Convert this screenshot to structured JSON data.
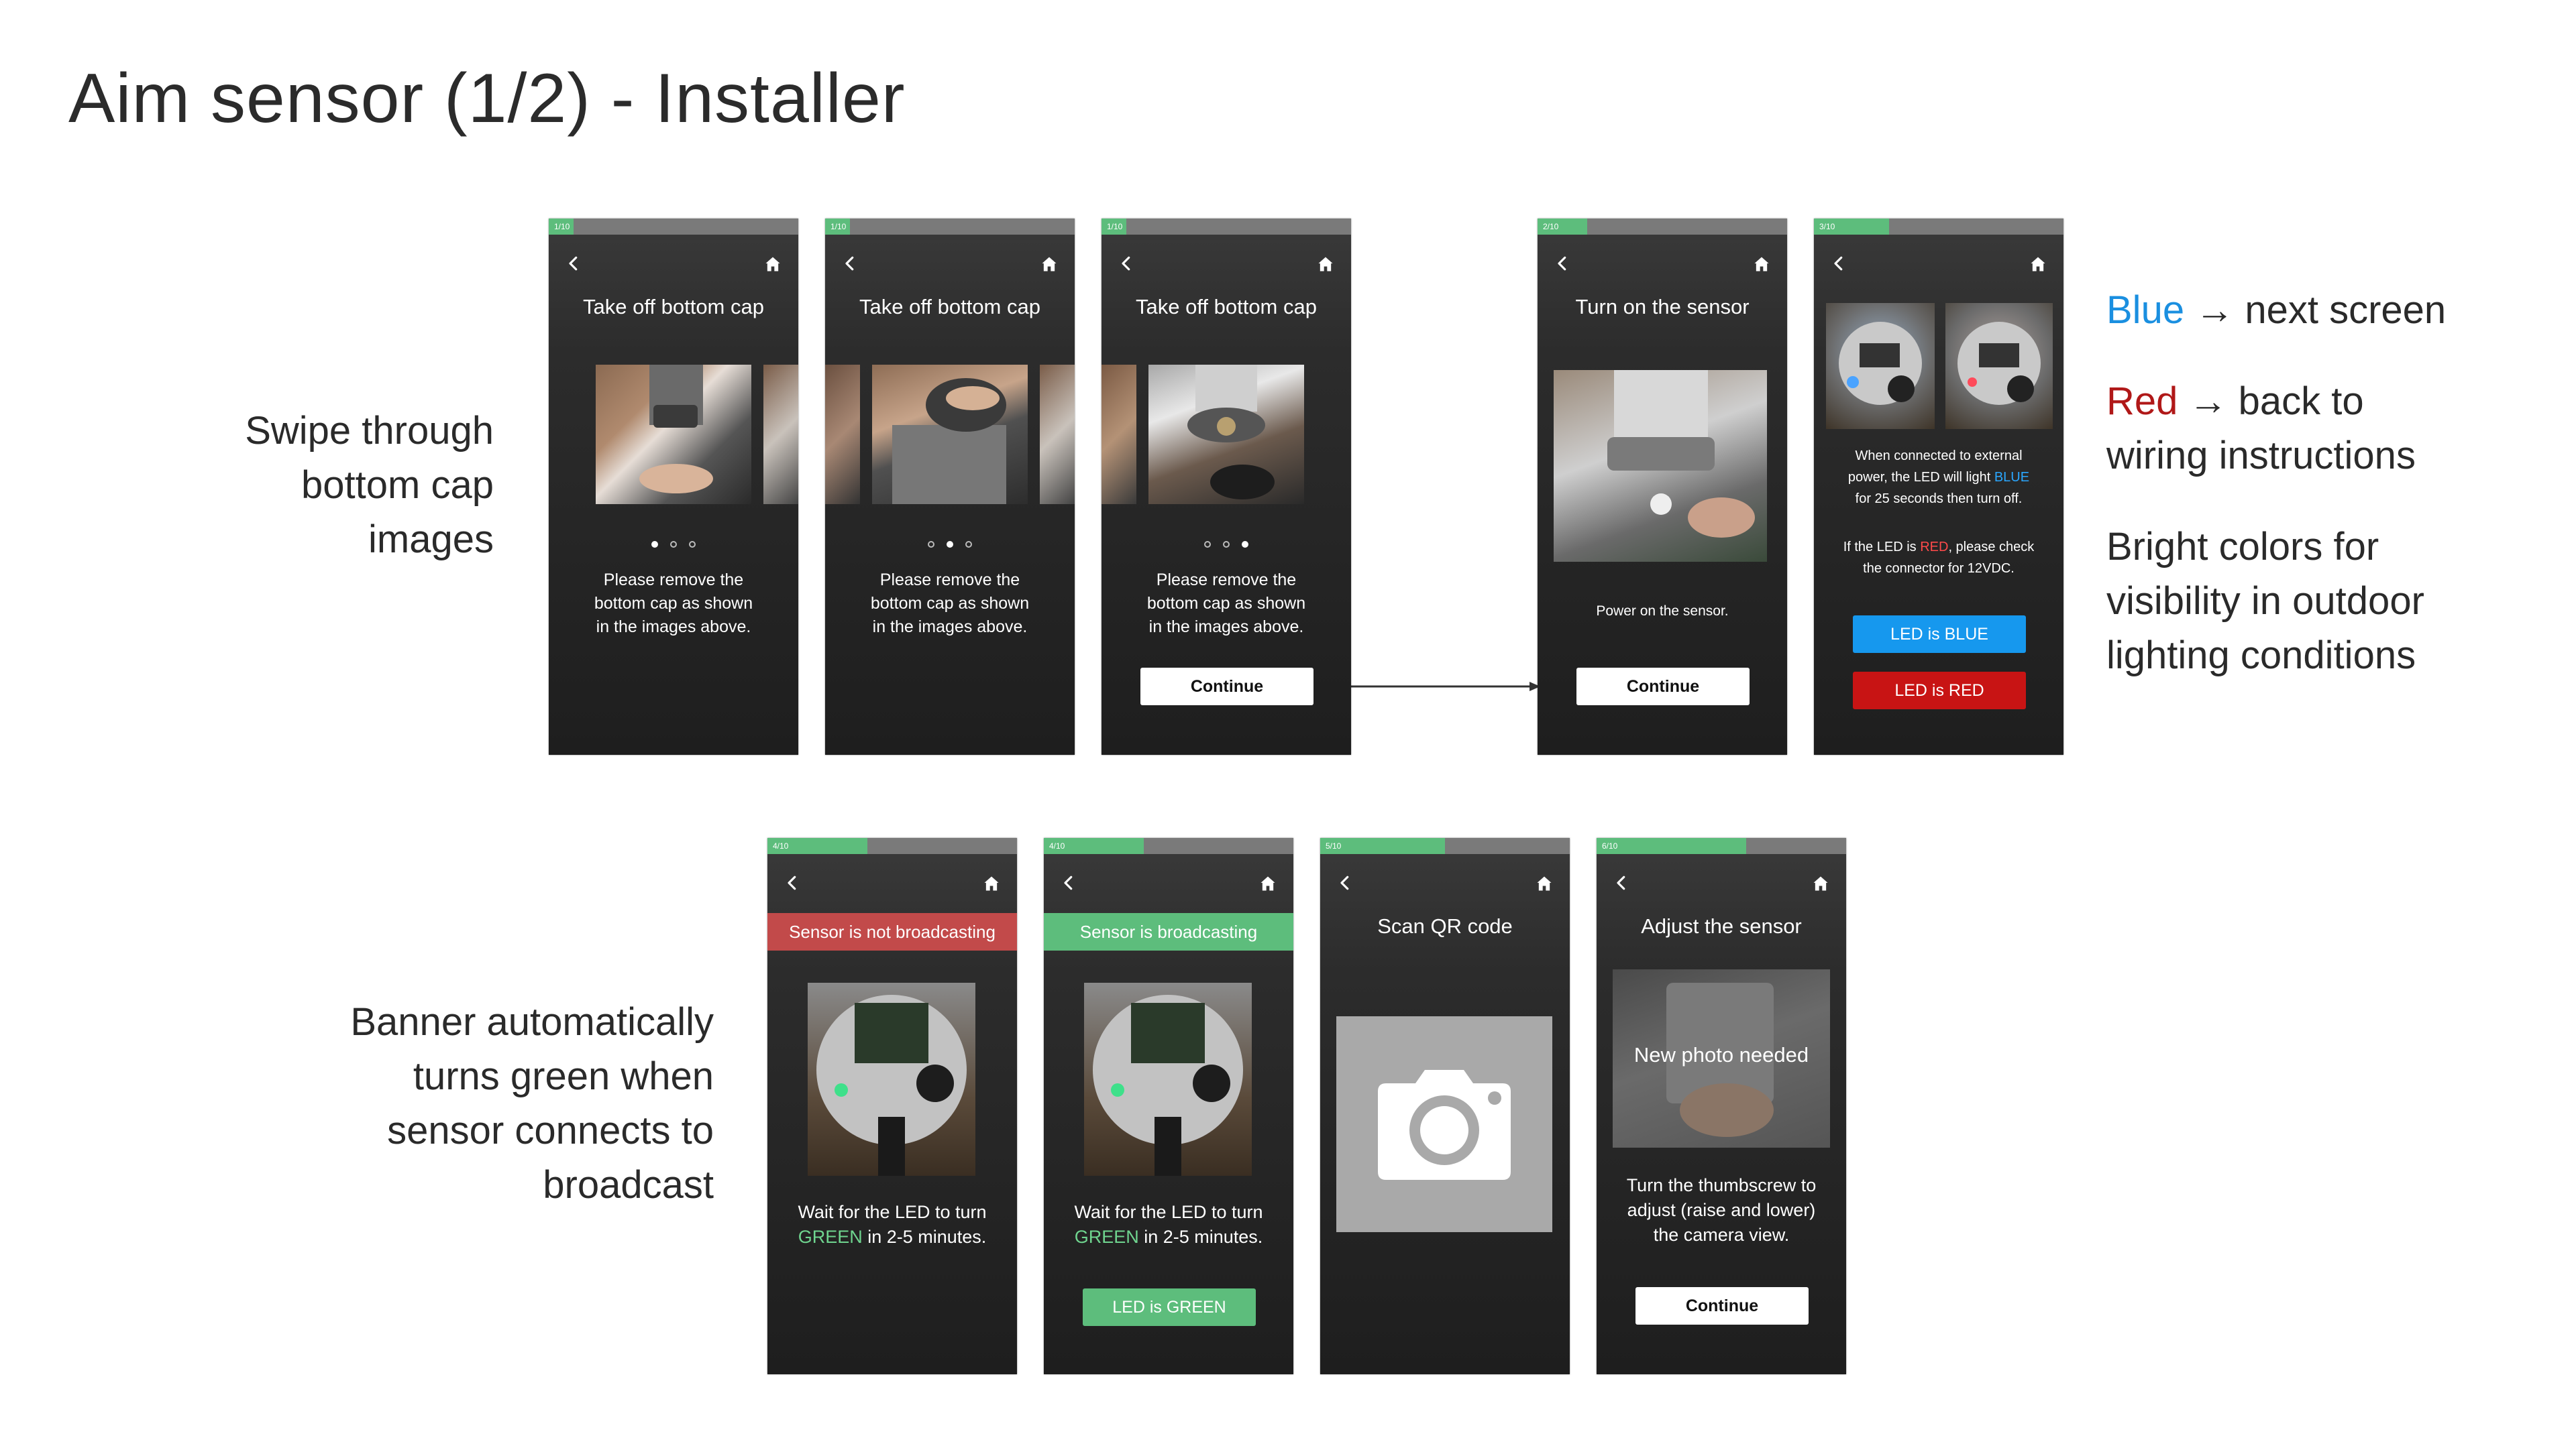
{
  "page": {
    "title": "Aim sensor (1/2) - Installer"
  },
  "captions": {
    "swipe": [
      "Swipe through",
      "bottom cap",
      "images"
    ],
    "banner": [
      "Banner automatically",
      "turns green when",
      "sensor connects to",
      "broadcast"
    ]
  },
  "notes": {
    "blue_word": "Blue",
    "blue_rest": " → next screen",
    "red_word": "Red",
    "red_rest": " → back to",
    "red_line2": "wiring instructions",
    "bright": [
      "Bright colors for",
      "visibility in outdoor",
      "lighting conditions"
    ]
  },
  "colors": {
    "blue": "#1a8fe0",
    "red": "#b01818",
    "green": "#5dbd7c",
    "banner_red": "#c24a4a"
  },
  "screens": {
    "s1": {
      "step": "1/10",
      "progress": 0.1,
      "title": "Take off bottom cap",
      "text": [
        "Please remove the",
        "bottom cap as shown",
        "in the images above."
      ],
      "dot_active": 1
    },
    "s2": {
      "step": "1/10",
      "progress": 0.1,
      "title": "Take off bottom cap",
      "text": [
        "Please remove the",
        "bottom cap as shown",
        "in the images above."
      ],
      "dot_active": 2
    },
    "s3": {
      "step": "1/10",
      "progress": 0.1,
      "title": "Take off bottom cap",
      "text": [
        "Please remove the",
        "bottom cap as shown",
        "in the images above."
      ],
      "dot_active": 3,
      "button": "Continue"
    },
    "s4": {
      "step": "2/10",
      "progress": 0.2,
      "title": "Turn on the sensor",
      "text": "Power on the sensor.",
      "button": "Continue"
    },
    "s5": {
      "step": "3/10",
      "progress": 0.3,
      "text1": [
        "When connected to external",
        "power, the LED will light",
        "for 25 seconds then turn off."
      ],
      "text1_blue": "BLUE",
      "text2_a": "If the LED is ",
      "text2_red": "RED",
      "text2_b": ", please check",
      "text2_line2": "the connector for 12VDC.",
      "btn_blue": "LED is BLUE",
      "btn_red": "LED is RED"
    },
    "s6": {
      "step": "4/10",
      "progress": 0.4,
      "banner": "Sensor is not broadcasting",
      "text_a": "Wait for the LED to turn",
      "text_green": "GREEN",
      "text_b": " in 2-5 minutes."
    },
    "s7": {
      "step": "4/10",
      "progress": 0.4,
      "banner": "Sensor is broadcasting",
      "text_a": "Wait for the LED to turn",
      "text_green": "GREEN",
      "text_b": " in 2-5 minutes.",
      "button": "LED is GREEN"
    },
    "s8": {
      "step": "5/10",
      "progress": 0.5,
      "title": "Scan QR code"
    },
    "s9": {
      "step": "6/10",
      "progress": 0.6,
      "title": "Adjust the sensor",
      "overlay": "New photo needed",
      "text": [
        "Turn the thumbscrew to",
        "adjust (raise and lower)",
        "the camera view."
      ],
      "button": "Continue"
    }
  }
}
